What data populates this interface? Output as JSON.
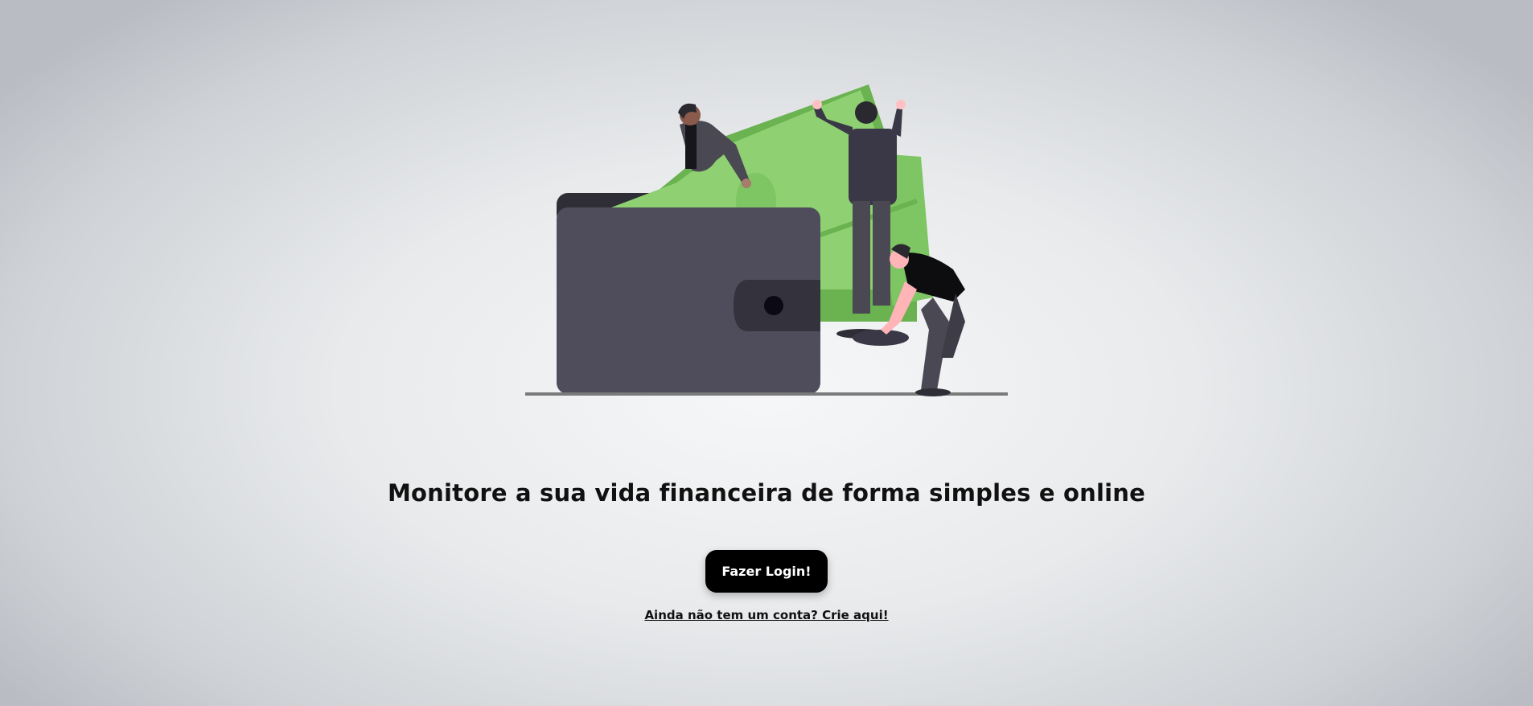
{
  "hero": {
    "illustration": "wallet-with-money-people-illustration"
  },
  "headline": "Monitore a sua vida financeira de forma simples e online",
  "login_button": "Fazer Login!",
  "signup_link": "Ainda não tem um conta? Crie aqui!",
  "colors": {
    "wallet": "#4f4d5c",
    "wallet_dark": "#34323c",
    "money": "#8fd072",
    "money_dark": "#6bb251",
    "button": "#000000",
    "text": "#111111"
  }
}
